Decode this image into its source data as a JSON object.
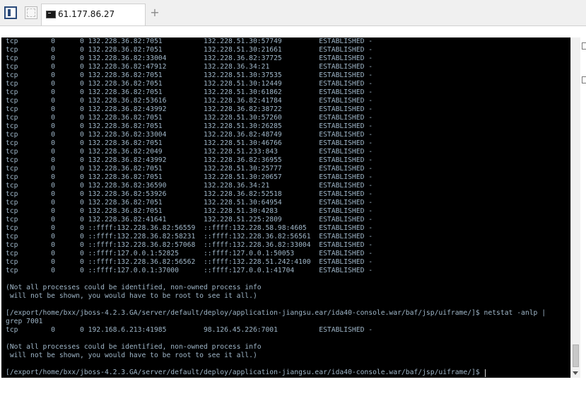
{
  "window": {
    "tab_title": "61.177.86.27",
    "new_tab_symbol": "+"
  },
  "icons": {
    "panel": "sidebar-toggle-icon",
    "grid": "quick-connect-icon",
    "terminal": "terminal-icon"
  },
  "colors": {
    "terminal_bg": "#000000",
    "terminal_text": "#9fb6c8",
    "chrome_bg": "#f0f0f0"
  },
  "terminal": {
    "lines": [
      "tcp        0      0 132.228.36.82:7051          132.228.51.30:57749         ESTABLISHED -",
      "tcp        0      0 132.228.36.82:7051          132.228.51.30:21661         ESTABLISHED -",
      "tcp        0      0 132.228.36.82:33004         132.228.36.82:37725         ESTABLISHED -",
      "tcp        0      0 132.228.36.82:47912         132.228.36.34:21            ESTABLISHED -",
      "tcp        0      0 132.228.36.82:7051          132.228.51.30:37535         ESTABLISHED -",
      "tcp        0      0 132.228.36.82:7051          132.228.51.30:12449         ESTABLISHED -",
      "tcp        0      0 132.228.36.82:7051          132.228.51.30:61862         ESTABLISHED -",
      "tcp        0      0 132.228.36.82:53616         132.228.36.82:41784         ESTABLISHED -",
      "tcp        0      0 132.228.36.82:43992         132.228.36.82:38722         ESTABLISHED -",
      "tcp        0      0 132.228.36.82:7051          132.228.51.30:57260         ESTABLISHED -",
      "tcp        0      0 132.228.36.82:7051          132.228.51.30:26285         ESTABLISHED -",
      "tcp        0      0 132.228.36.82:33004         132.228.36.82:48749         ESTABLISHED -",
      "tcp        0      0 132.228.36.82:7051          132.228.51.30:46766         ESTABLISHED -",
      "tcp        0      0 132.228.36.82:2049          132.228.51.233:843          ESTABLISHED -",
      "tcp        0      0 132.228.36.82:43992         132.228.36.82:36955         ESTABLISHED -",
      "tcp        0      0 132.228.36.82:7051          132.228.51.30:25777         ESTABLISHED -",
      "tcp        0      0 132.228.36.82:7051          132.228.51.30:20657         ESTABLISHED -",
      "tcp        0      0 132.228.36.82:36590         132.228.36.34:21            ESTABLISHED -",
      "tcp        0      0 132.228.36.82:53926         132.228.36.82:52518         ESTABLISHED -",
      "tcp        0      0 132.228.36.82:7051          132.228.51.30:64954         ESTABLISHED -",
      "tcp        0      0 132.228.36.82:7051          132.228.51.30:4283          ESTABLISHED -",
      "tcp        0      0 132.228.36.82:41641         132.228.51.225:2809         ESTABLISHED -",
      "tcp        0      0 ::ffff:132.228.36.82:56559  ::ffff:132.228.58.98:4605   ESTABLISHED -",
      "tcp        0      0 ::ffff:132.228.36.82:58231  ::ffff:132.228.36.82:56561  ESTABLISHED -",
      "tcp        0      0 ::ffff:132.228.36.82:57068  ::ffff:132.228.36.82:33004  ESTABLISHED -",
      "tcp        0      0 ::ffff:127.0.0.1:52825      ::ffff:127.0.0.1:50053      ESTABLISHED -",
      "tcp        0      0 ::ffff:132.228.36.82:56562  ::ffff:132.228.51.242:4100  ESTABLISHED -",
      "tcp        0      0 ::ffff:127.0.0.1:37000      ::ffff:127.0.0.1:41704      ESTABLISHED -",
      "",
      "(Not all processes could be identified, non-owned process info",
      " will not be shown, you would have to be root to see it all.)",
      "",
      "[/export/home/bxx/jboss-4.2.3.GA/server/default/deploy/application-jiangsu.ear/ida40-console.war/baf/jsp/uiframe/]$ netstat -anlp |",
      "grep 7001",
      "tcp        0      0 192.168.6.213:41985         98.126.45.226:7001          ESTABLISHED -",
      "",
      "(Not all processes could be identified, non-owned process info",
      " will not be shown, you would have to be root to see it all.)",
      "",
      "[/export/home/bxx/jboss-4.2.3.GA/server/default/deploy/application-jiangsu.ear/ida40-console.war/baf/jsp/uiframe/]$ "
    ]
  }
}
